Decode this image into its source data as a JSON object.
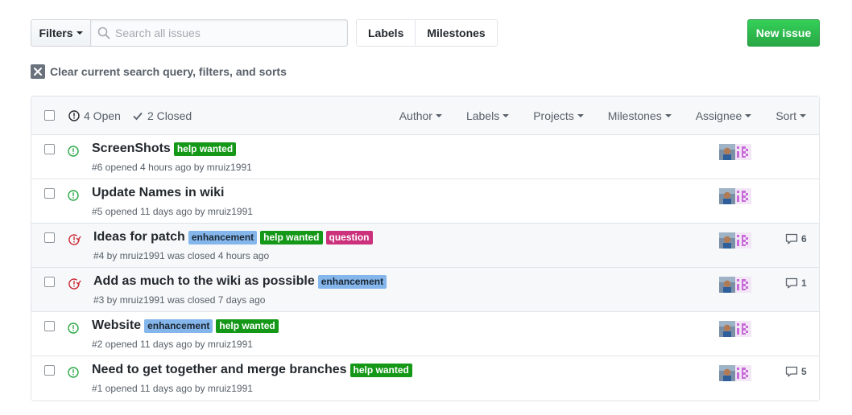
{
  "toolbar": {
    "filters_label": "Filters",
    "search_placeholder": "Search all issues",
    "search_value": "",
    "labels_label": "Labels",
    "milestones_label": "Milestones",
    "new_issue_label": "New issue"
  },
  "clear_query_label": "Clear current search query, filters, and sorts",
  "header": {
    "open_label": "4 Open",
    "closed_label": "2 Closed",
    "sorts": [
      "Author",
      "Labels",
      "Projects",
      "Milestones",
      "Assignee",
      "Sort"
    ]
  },
  "label_colors": {
    "help wanted": {
      "bg": "#159818",
      "fg": "#ffffff"
    },
    "enhancement": {
      "bg": "#84b6eb",
      "fg": "#1c2733"
    },
    "question": {
      "bg": "#cc317c",
      "fg": "#ffffff"
    }
  },
  "colors": {
    "open": "#28a745",
    "closed": "#cb2431",
    "primary_button": "#2ea44f"
  },
  "issues": [
    {
      "title": "ScreenShots",
      "state": "open",
      "labels": [
        "help wanted"
      ],
      "meta": "#6 opened 4 hours ago by mruiz1991",
      "comments": ""
    },
    {
      "title": "Update Names in wiki",
      "state": "open",
      "labels": [],
      "meta": "#5 opened 11 days ago by mruiz1991",
      "comments": ""
    },
    {
      "title": "Ideas for patch",
      "state": "closed",
      "labels": [
        "enhancement",
        "help wanted",
        "question"
      ],
      "meta": "#4 by mruiz1991 was closed 4 hours ago",
      "comments": "6"
    },
    {
      "title": "Add as much to the wiki as possible",
      "state": "closed",
      "labels": [
        "enhancement"
      ],
      "meta": "#3 by mruiz1991 was closed 7 days ago",
      "comments": "1"
    },
    {
      "title": "Website",
      "state": "open",
      "labels": [
        "enhancement",
        "help wanted"
      ],
      "meta": "#2 opened 11 days ago by mruiz1991",
      "comments": ""
    },
    {
      "title": "Need to get together and merge branches",
      "state": "open",
      "labels": [
        "help wanted"
      ],
      "meta": "#1 opened 11 days ago by mruiz1991",
      "comments": "5"
    }
  ]
}
